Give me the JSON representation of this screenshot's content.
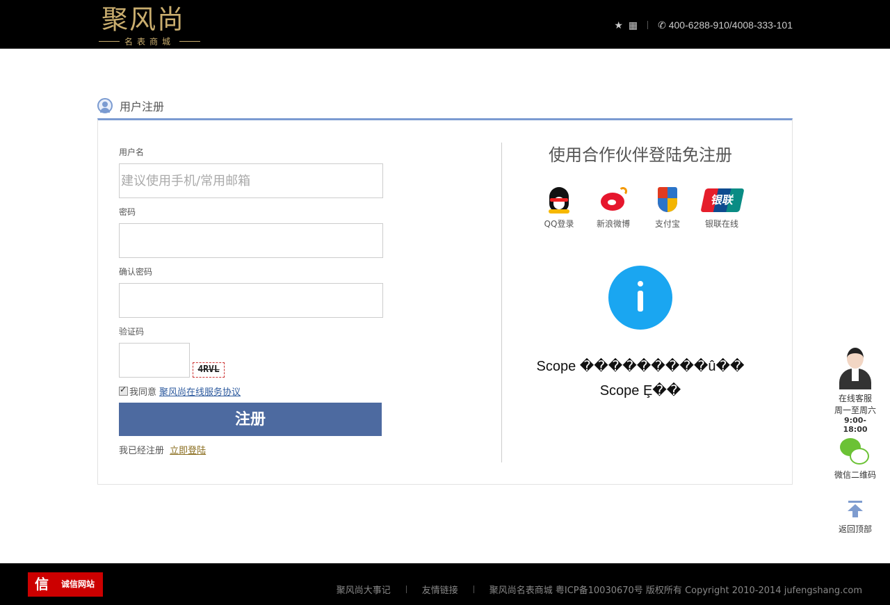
{
  "header": {
    "logo_main": "聚风尚",
    "logo_sub": "名表商城",
    "star_icon": "★",
    "phone": "✆ 400-6288-910/4008-333-101"
  },
  "section": {
    "title": "用户注册"
  },
  "form": {
    "username_label": "用户名",
    "username_placeholder": "建议使用手机/常用邮箱",
    "password_label": "密码",
    "confirm_label": "确认密码",
    "captcha_label": "验证码",
    "captcha_text": "4RVL",
    "agree_text": "我同意",
    "agree_link": "聚风尚在线服务协议",
    "submit_label": "注册",
    "have_account": "我已经注册",
    "login_link": "立即登陆"
  },
  "partner": {
    "title": "使用合作伙伴登陆免注册",
    "items": [
      {
        "label": "QQ登录",
        "icon": "qq-icon"
      },
      {
        "label": "新浪微博",
        "icon": "weibo-icon"
      },
      {
        "label": "支付宝",
        "icon": "alipay-icon"
      },
      {
        "label": "银联在线",
        "icon": "unionpay-icon",
        "badge": "银联"
      }
    ],
    "info_line1": "Scope ���������û��",
    "info_line2": "Scope Ȩ��"
  },
  "side": {
    "service_label": "在线客服",
    "service_hours_days": "周一至周六",
    "service_hours_time": "9:00-18:00",
    "wechat_label": "微信二维码",
    "top_label": "返回顶部"
  },
  "footer": {
    "trust_badge": "信",
    "trust_text": "诚信网站",
    "links": [
      "聚风尚大事记",
      "友情链接",
      "聚风尚名表商城 粤ICP备10030670号 版权所有 Copyright 2010-2014 jufengshang.com"
    ]
  },
  "colors": {
    "accent": "#7b9bd1",
    "button": "#4d6aa0",
    "info": "#1aa6f1",
    "header_bg": "#000000",
    "gold": "#c9ad6e"
  }
}
